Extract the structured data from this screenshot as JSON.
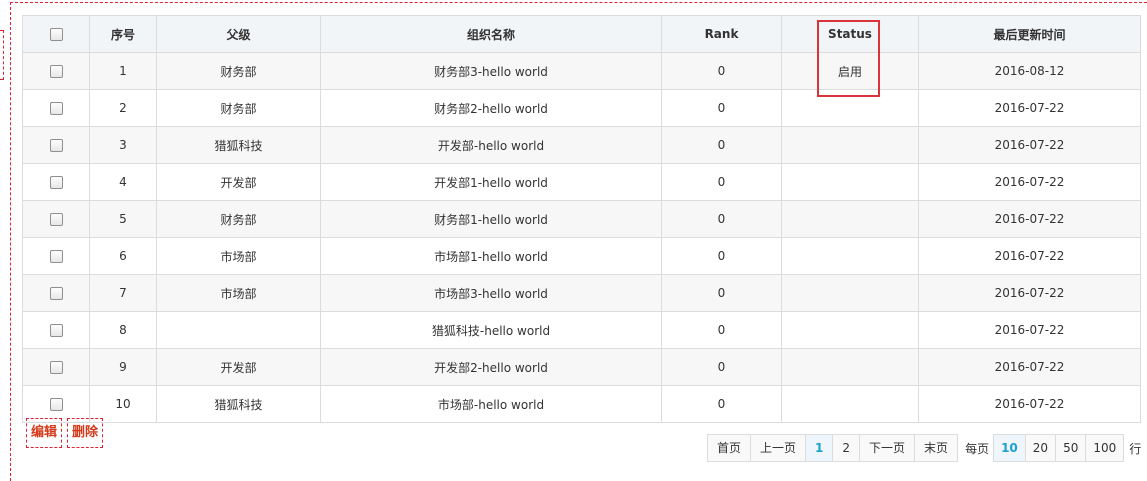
{
  "table": {
    "headers": {
      "index": "序号",
      "parent": "父级",
      "org_name": "组织名称",
      "rank": "Rank",
      "status": "Status",
      "updated": "最后更新时间"
    },
    "rows": [
      {
        "index": "1",
        "parent": "财务部",
        "name": "财务部3-hello world",
        "rank": "0",
        "status": "启用",
        "updated": "2016-08-12"
      },
      {
        "index": "2",
        "parent": "财务部",
        "name": "财务部2-hello world",
        "rank": "0",
        "status": "",
        "updated": "2016-07-22"
      },
      {
        "index": "3",
        "parent": "猎狐科技",
        "name": "开发部-hello world",
        "rank": "0",
        "status": "",
        "updated": "2016-07-22"
      },
      {
        "index": "4",
        "parent": "开发部",
        "name": "开发部1-hello world",
        "rank": "0",
        "status": "",
        "updated": "2016-07-22"
      },
      {
        "index": "5",
        "parent": "财务部",
        "name": "财务部1-hello world",
        "rank": "0",
        "status": "",
        "updated": "2016-07-22"
      },
      {
        "index": "6",
        "parent": "市场部",
        "name": "市场部1-hello world",
        "rank": "0",
        "status": "",
        "updated": "2016-07-22"
      },
      {
        "index": "7",
        "parent": "市场部",
        "name": "市场部3-hello world",
        "rank": "0",
        "status": "",
        "updated": "2016-07-22"
      },
      {
        "index": "8",
        "parent": "",
        "name": "猎狐科技-hello world",
        "rank": "0",
        "status": "",
        "updated": "2016-07-22"
      },
      {
        "index": "9",
        "parent": "开发部",
        "name": "开发部2-hello world",
        "rank": "0",
        "status": "",
        "updated": "2016-07-22"
      },
      {
        "index": "10",
        "parent": "猎狐科技",
        "name": "市场部-hello world",
        "rank": "0",
        "status": "",
        "updated": "2016-07-22"
      }
    ]
  },
  "actions": {
    "edit": "编辑",
    "delete": "删除"
  },
  "pagination": {
    "first": "首页",
    "prev": "上一页",
    "pages": [
      "1",
      "2"
    ],
    "current_page": "1",
    "next": "下一页",
    "last": "末页",
    "per_page_label": "每页",
    "per_page_options": [
      "10",
      "20",
      "50",
      "100"
    ],
    "per_page_selected": "10",
    "per_page_suffix": "行"
  },
  "colors": {
    "highlight": "#d9343a",
    "action_text": "#d43a1a",
    "active_page": "#1aa1d1"
  }
}
